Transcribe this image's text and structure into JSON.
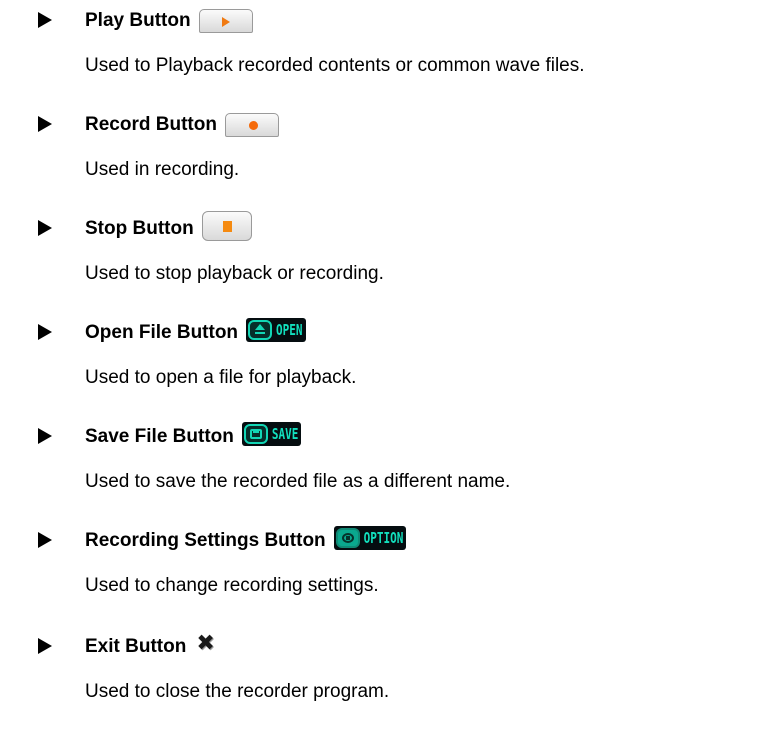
{
  "items": [
    {
      "heading": "Play Button",
      "description": "Used to Playback recorded contents or common wave files.",
      "icon": "play-icon"
    },
    {
      "heading": "Record Button",
      "description": "Used in recording.",
      "icon": "record-icon"
    },
    {
      "heading": "Stop Button",
      "description": "Used to stop playback or recording.",
      "icon": "stop-icon"
    },
    {
      "heading": "Open File Button",
      "description": "Used to open a file for playback.",
      "icon": "eject-icon",
      "icon_label": "OPEN"
    },
    {
      "heading": "Save File Button",
      "description": "Used to save the recorded file as a different name.",
      "icon": "save-icon",
      "icon_label": "SAVE"
    },
    {
      "heading": "Recording Settings Button",
      "description": "Used to change recording settings.",
      "icon": "settings-icon",
      "icon_label": "OPTION"
    },
    {
      "heading": "Exit Button",
      "description": "Used to close the recorder program.",
      "icon": "close-icon"
    }
  ],
  "colors": {
    "accent_orange": "#f07a12",
    "teal": "#12d6b5",
    "dark_button": "#050d10"
  }
}
